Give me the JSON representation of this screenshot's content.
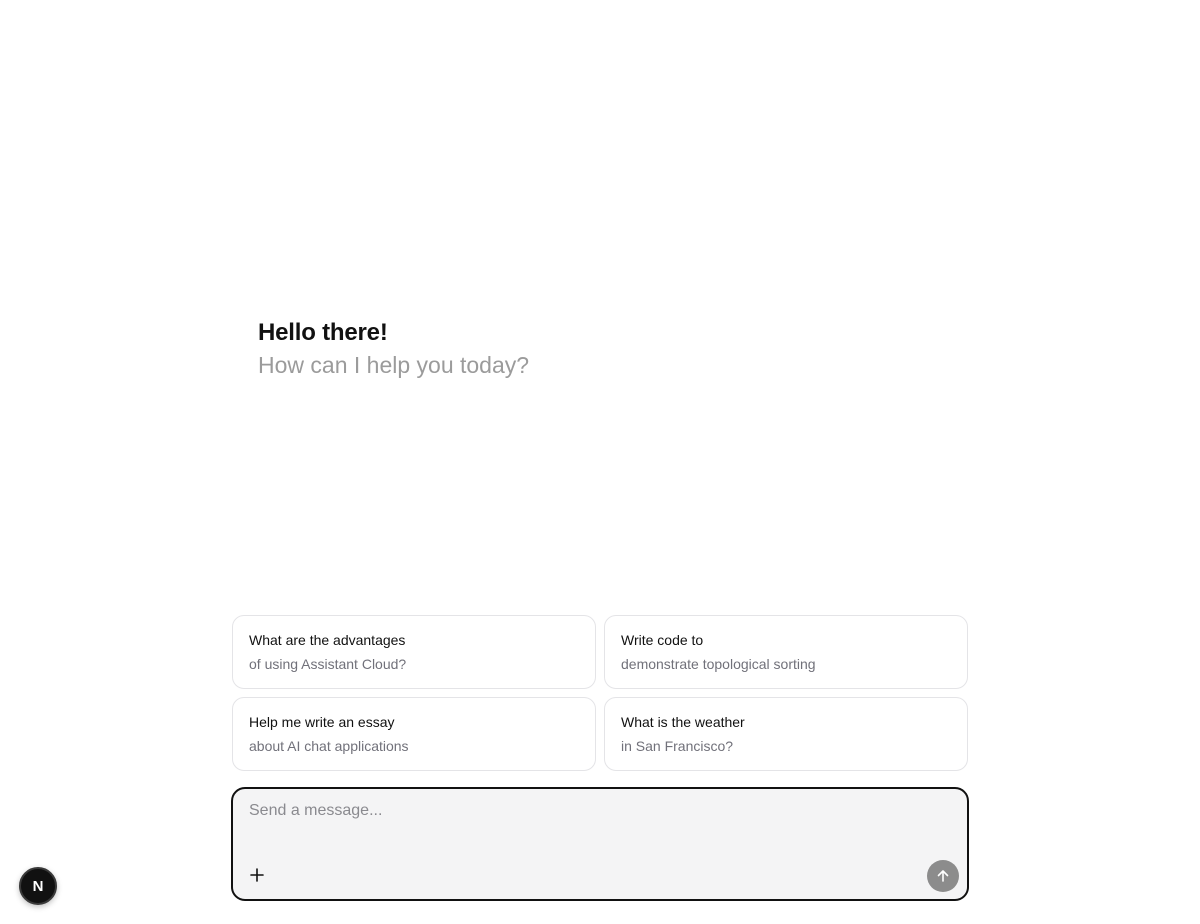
{
  "greeting": {
    "title": "Hello there!",
    "subtitle": "How can I help you today?"
  },
  "suggestions": [
    {
      "title": "What are the advantages",
      "subtitle": "of using Assistant Cloud?"
    },
    {
      "title": "Write code to",
      "subtitle": "demonstrate topological sorting"
    },
    {
      "title": "Help me write an essay",
      "subtitle": "about AI chat applications"
    },
    {
      "title": "What is the weather",
      "subtitle": "in San Francisco?"
    }
  ],
  "composer": {
    "placeholder": "Send a message...",
    "value": "",
    "attach_icon": "plus-icon",
    "send_icon": "arrow-up-icon"
  },
  "badge": {
    "letter": "N",
    "icon": "nextjs-logo-icon"
  },
  "colors": {
    "background": "#ffffff",
    "text": "#111111",
    "muted": "#9b9b9b",
    "card_border": "#e4e4e7",
    "composer_bg": "#f4f4f5",
    "composer_border": "#111111",
    "send_button": "#8c8c8c",
    "badge_bg": "#111111"
  }
}
